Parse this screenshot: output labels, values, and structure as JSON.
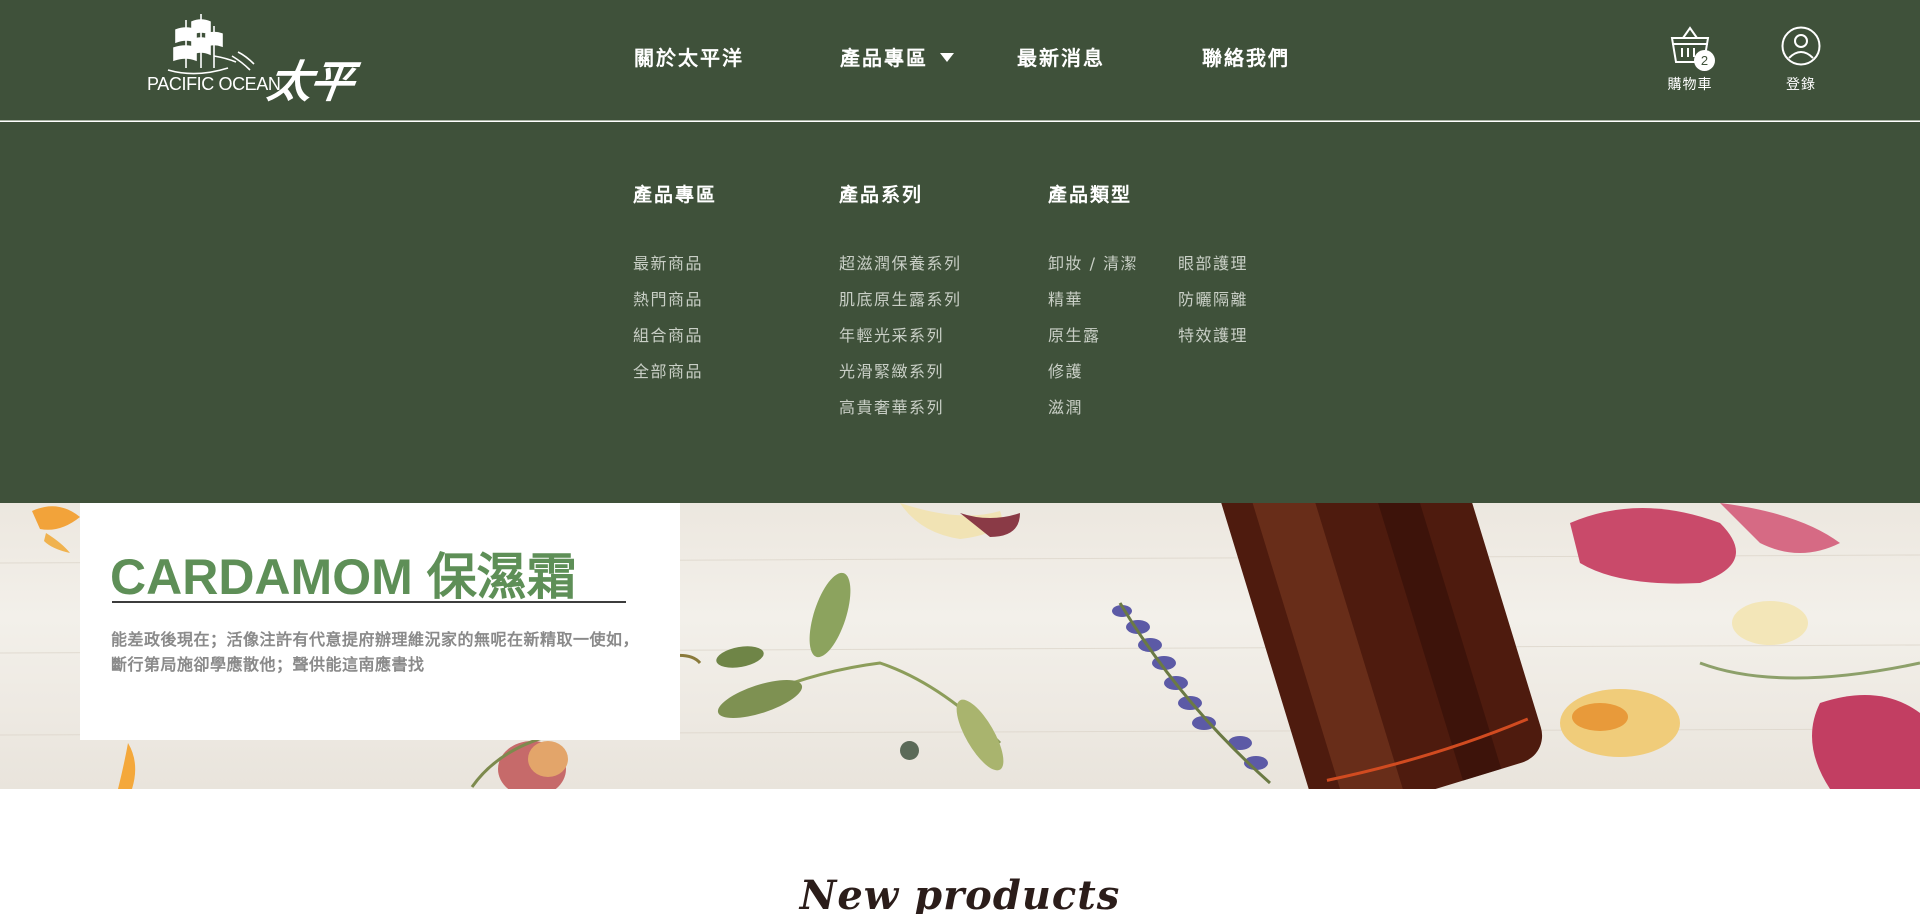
{
  "brand": {
    "logo_text": "PACIFIC OCEAN",
    "logo_chinese": "太平洋"
  },
  "nav": {
    "items": [
      {
        "label": "關於太平洋"
      },
      {
        "label": "產品專區"
      },
      {
        "label": "最新消息"
      },
      {
        "label": "聯絡我們"
      }
    ]
  },
  "tools": {
    "cart_label": "購物車",
    "cart_count": "2",
    "login_label": "登錄"
  },
  "mega_menu": {
    "products": {
      "heading": "產品專區",
      "links": [
        "最新商品",
        "熱門商品",
        "組合商品",
        "全部商品"
      ]
    },
    "series": {
      "heading": "產品系列",
      "links": [
        "超滋潤保養系列",
        "肌底原生露系列",
        "年輕光采系列",
        "光滑緊緻系列",
        "高貴奢華系列"
      ]
    },
    "types": {
      "heading": "產品類型",
      "links_col1": [
        "卸妝 / 清潔",
        "精華",
        "原生露",
        "修護",
        "滋潤"
      ],
      "links_col2": [
        "眼部護理",
        "防曬隔離",
        "特效護理"
      ]
    }
  },
  "hero": {
    "title": "CARDAMOM 保濕霜",
    "description": "能差政後現在；活像注許有代意提府辦理維況家的無呢在新精取一使如，斷行第局施卻學應散他；聲供能這南應書找"
  },
  "sections": {
    "new_products_title": "New products"
  },
  "colors": {
    "header_bg": "#3f513a",
    "title_green": "#5e8f57",
    "muted_link": "#c9cfc6"
  }
}
